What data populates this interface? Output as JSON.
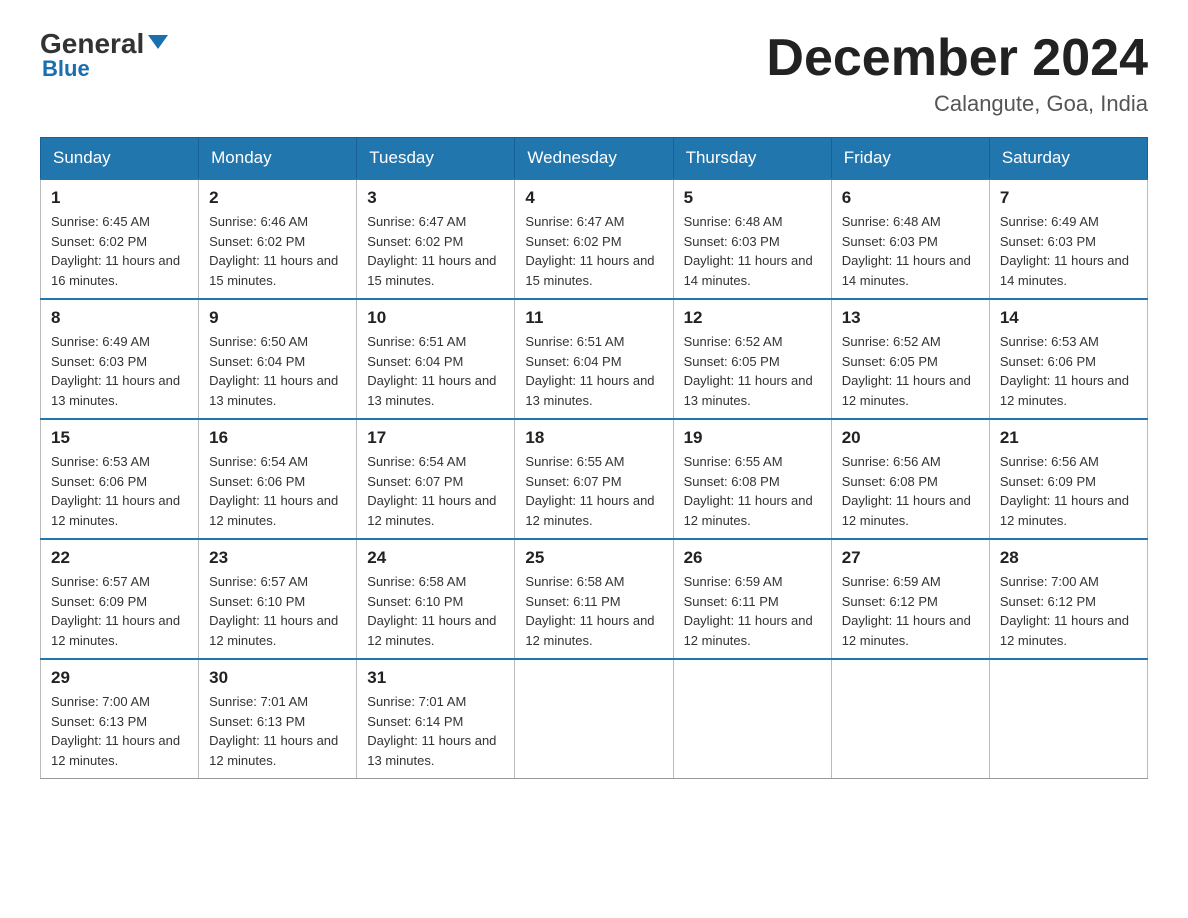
{
  "header": {
    "logo_general": "General",
    "logo_blue": "Blue",
    "main_title": "December 2024",
    "subtitle": "Calangute, Goa, India"
  },
  "days_of_week": [
    "Sunday",
    "Monday",
    "Tuesday",
    "Wednesday",
    "Thursday",
    "Friday",
    "Saturday"
  ],
  "weeks": [
    [
      {
        "day": "1",
        "sunrise": "Sunrise: 6:45 AM",
        "sunset": "Sunset: 6:02 PM",
        "daylight": "Daylight: 11 hours and 16 minutes."
      },
      {
        "day": "2",
        "sunrise": "Sunrise: 6:46 AM",
        "sunset": "Sunset: 6:02 PM",
        "daylight": "Daylight: 11 hours and 15 minutes."
      },
      {
        "day": "3",
        "sunrise": "Sunrise: 6:47 AM",
        "sunset": "Sunset: 6:02 PM",
        "daylight": "Daylight: 11 hours and 15 minutes."
      },
      {
        "day": "4",
        "sunrise": "Sunrise: 6:47 AM",
        "sunset": "Sunset: 6:02 PM",
        "daylight": "Daylight: 11 hours and 15 minutes."
      },
      {
        "day": "5",
        "sunrise": "Sunrise: 6:48 AM",
        "sunset": "Sunset: 6:03 PM",
        "daylight": "Daylight: 11 hours and 14 minutes."
      },
      {
        "day": "6",
        "sunrise": "Sunrise: 6:48 AM",
        "sunset": "Sunset: 6:03 PM",
        "daylight": "Daylight: 11 hours and 14 minutes."
      },
      {
        "day": "7",
        "sunrise": "Sunrise: 6:49 AM",
        "sunset": "Sunset: 6:03 PM",
        "daylight": "Daylight: 11 hours and 14 minutes."
      }
    ],
    [
      {
        "day": "8",
        "sunrise": "Sunrise: 6:49 AM",
        "sunset": "Sunset: 6:03 PM",
        "daylight": "Daylight: 11 hours and 13 minutes."
      },
      {
        "day": "9",
        "sunrise": "Sunrise: 6:50 AM",
        "sunset": "Sunset: 6:04 PM",
        "daylight": "Daylight: 11 hours and 13 minutes."
      },
      {
        "day": "10",
        "sunrise": "Sunrise: 6:51 AM",
        "sunset": "Sunset: 6:04 PM",
        "daylight": "Daylight: 11 hours and 13 minutes."
      },
      {
        "day": "11",
        "sunrise": "Sunrise: 6:51 AM",
        "sunset": "Sunset: 6:04 PM",
        "daylight": "Daylight: 11 hours and 13 minutes."
      },
      {
        "day": "12",
        "sunrise": "Sunrise: 6:52 AM",
        "sunset": "Sunset: 6:05 PM",
        "daylight": "Daylight: 11 hours and 13 minutes."
      },
      {
        "day": "13",
        "sunrise": "Sunrise: 6:52 AM",
        "sunset": "Sunset: 6:05 PM",
        "daylight": "Daylight: 11 hours and 12 minutes."
      },
      {
        "day": "14",
        "sunrise": "Sunrise: 6:53 AM",
        "sunset": "Sunset: 6:06 PM",
        "daylight": "Daylight: 11 hours and 12 minutes."
      }
    ],
    [
      {
        "day": "15",
        "sunrise": "Sunrise: 6:53 AM",
        "sunset": "Sunset: 6:06 PM",
        "daylight": "Daylight: 11 hours and 12 minutes."
      },
      {
        "day": "16",
        "sunrise": "Sunrise: 6:54 AM",
        "sunset": "Sunset: 6:06 PM",
        "daylight": "Daylight: 11 hours and 12 minutes."
      },
      {
        "day": "17",
        "sunrise": "Sunrise: 6:54 AM",
        "sunset": "Sunset: 6:07 PM",
        "daylight": "Daylight: 11 hours and 12 minutes."
      },
      {
        "day": "18",
        "sunrise": "Sunrise: 6:55 AM",
        "sunset": "Sunset: 6:07 PM",
        "daylight": "Daylight: 11 hours and 12 minutes."
      },
      {
        "day": "19",
        "sunrise": "Sunrise: 6:55 AM",
        "sunset": "Sunset: 6:08 PM",
        "daylight": "Daylight: 11 hours and 12 minutes."
      },
      {
        "day": "20",
        "sunrise": "Sunrise: 6:56 AM",
        "sunset": "Sunset: 6:08 PM",
        "daylight": "Daylight: 11 hours and 12 minutes."
      },
      {
        "day": "21",
        "sunrise": "Sunrise: 6:56 AM",
        "sunset": "Sunset: 6:09 PM",
        "daylight": "Daylight: 11 hours and 12 minutes."
      }
    ],
    [
      {
        "day": "22",
        "sunrise": "Sunrise: 6:57 AM",
        "sunset": "Sunset: 6:09 PM",
        "daylight": "Daylight: 11 hours and 12 minutes."
      },
      {
        "day": "23",
        "sunrise": "Sunrise: 6:57 AM",
        "sunset": "Sunset: 6:10 PM",
        "daylight": "Daylight: 11 hours and 12 minutes."
      },
      {
        "day": "24",
        "sunrise": "Sunrise: 6:58 AM",
        "sunset": "Sunset: 6:10 PM",
        "daylight": "Daylight: 11 hours and 12 minutes."
      },
      {
        "day": "25",
        "sunrise": "Sunrise: 6:58 AM",
        "sunset": "Sunset: 6:11 PM",
        "daylight": "Daylight: 11 hours and 12 minutes."
      },
      {
        "day": "26",
        "sunrise": "Sunrise: 6:59 AM",
        "sunset": "Sunset: 6:11 PM",
        "daylight": "Daylight: 11 hours and 12 minutes."
      },
      {
        "day": "27",
        "sunrise": "Sunrise: 6:59 AM",
        "sunset": "Sunset: 6:12 PM",
        "daylight": "Daylight: 11 hours and 12 minutes."
      },
      {
        "day": "28",
        "sunrise": "Sunrise: 7:00 AM",
        "sunset": "Sunset: 6:12 PM",
        "daylight": "Daylight: 11 hours and 12 minutes."
      }
    ],
    [
      {
        "day": "29",
        "sunrise": "Sunrise: 7:00 AM",
        "sunset": "Sunset: 6:13 PM",
        "daylight": "Daylight: 11 hours and 12 minutes."
      },
      {
        "day": "30",
        "sunrise": "Sunrise: 7:01 AM",
        "sunset": "Sunset: 6:13 PM",
        "daylight": "Daylight: 11 hours and 12 minutes."
      },
      {
        "day": "31",
        "sunrise": "Sunrise: 7:01 AM",
        "sunset": "Sunset: 6:14 PM",
        "daylight": "Daylight: 11 hours and 13 minutes."
      },
      {
        "day": "",
        "sunrise": "",
        "sunset": "",
        "daylight": ""
      },
      {
        "day": "",
        "sunrise": "",
        "sunset": "",
        "daylight": ""
      },
      {
        "day": "",
        "sunrise": "",
        "sunset": "",
        "daylight": ""
      },
      {
        "day": "",
        "sunrise": "",
        "sunset": "",
        "daylight": ""
      }
    ]
  ]
}
